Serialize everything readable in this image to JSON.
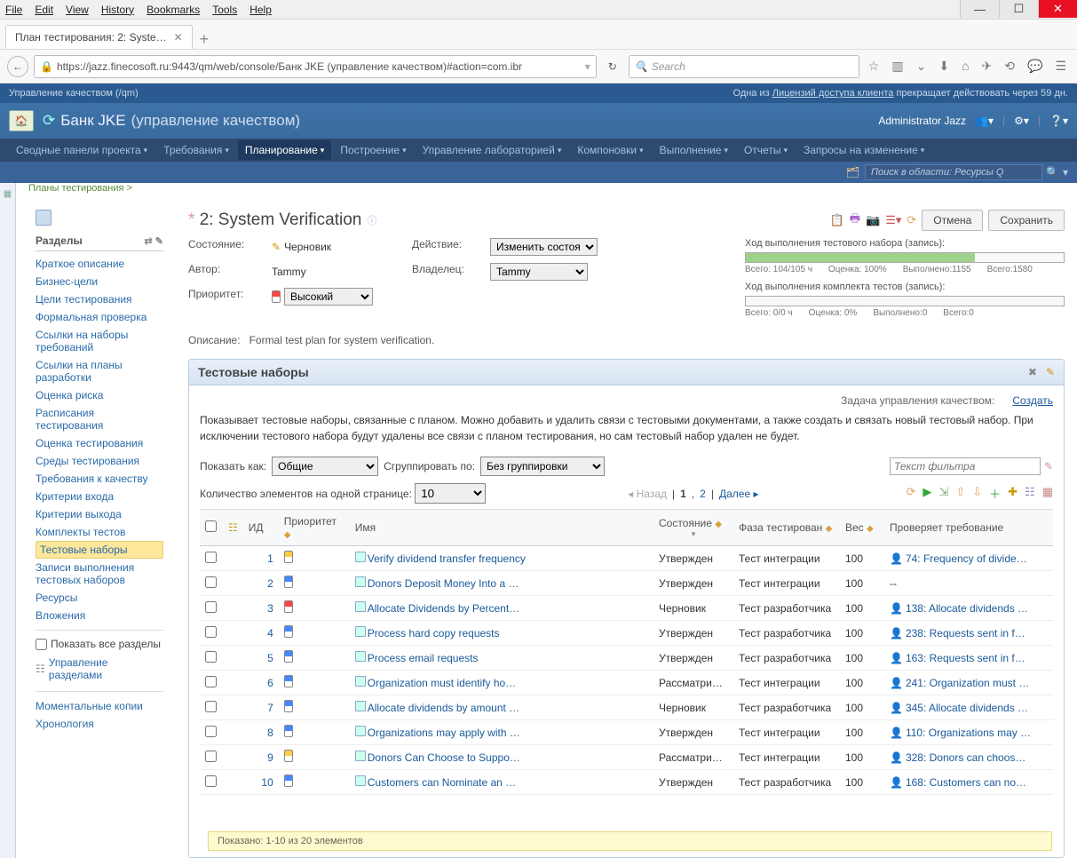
{
  "os_menu": [
    "File",
    "Edit",
    "View",
    "History",
    "Bookmarks",
    "Tools",
    "Help"
  ],
  "window": {
    "min": "—",
    "max": "☐",
    "close": "✕"
  },
  "browser_tab": {
    "title": "План тестирования: 2: Syste…"
  },
  "url": "https://jazz.finecosoft.ru:9443/qm/web/console/Банк JKE (управление качеством)#action=com.ibr",
  "search_placeholder": "Search",
  "topbar": {
    "left": "Управление качеством (/qm)",
    "right_prefix": "Одна из ",
    "right_link": "Лицензий доступа клиента",
    "right_suffix": " прекращает действовать через 59 дн."
  },
  "banner": {
    "title_main": "Банк JKE",
    "title_sub": "(управление качеством)",
    "user": "Administrator Jazz"
  },
  "nav": [
    {
      "label": "Сводные панели проекта",
      "active": false
    },
    {
      "label": "Требования",
      "active": false
    },
    {
      "label": "Планирование",
      "active": true
    },
    {
      "label": "Построение",
      "active": false
    },
    {
      "label": "Управление лабораторией",
      "active": false
    },
    {
      "label": "Компоновки",
      "active": false
    },
    {
      "label": "Выполнение",
      "active": false
    },
    {
      "label": "Отчеты",
      "active": false
    },
    {
      "label": "Запросы на изменение",
      "active": false
    }
  ],
  "scope_search": "Поиск в области: Ресурсы Q",
  "breadcrumb": "Планы тестирования >",
  "page_title": "2: System Verification",
  "buttons": {
    "cancel": "Отмена",
    "save": "Сохранить"
  },
  "sections_header": "Разделы",
  "sections": [
    "Краткое описание",
    "Бизнес-цели",
    "Цели тестирования",
    "Формальная проверка",
    "Ссылки на наборы требований",
    "Ссылки на планы разработки",
    "Оценка риска",
    "Расписания тестирования",
    "Оценка тестирования",
    "Среды тестирования",
    "Требования к качеству",
    "Критерии входа",
    "Критерии выхода",
    "Комплекты тестов",
    "Тестовые наборы",
    "Записи выполнения тестовых наборов",
    "Ресурсы",
    "Вложения"
  ],
  "selected_section_idx": 14,
  "show_all": "Показать все разделы",
  "manage_sections": "Управление разделами",
  "snapshots": "Моментальные копии",
  "chronology": "Хронология",
  "meta": {
    "state_lbl": "Состояние:",
    "state_val": "Черновик",
    "action_lbl": "Действие:",
    "action_val": "Изменить состоя",
    "author_lbl": "Автор:",
    "author_val": "Tammy",
    "owner_lbl": "Владелец:",
    "owner_val": "Tammy",
    "priority_lbl": "Приоритет:",
    "priority_val": "Высокий",
    "desc_lbl": "Описание:",
    "desc_val": "Formal test plan for system verification."
  },
  "progress1": {
    "title": "Ход выполнения тестового набора (запись):",
    "s1": "Всего: 104/105 ч",
    "s2": "Оценка: 100%",
    "s3": "Выполнено:1155",
    "s4": "Всего:1580"
  },
  "progress2": {
    "title": "Ход выполнения комплекта тестов (запись):",
    "s1": "Всего: 0/0 ч",
    "s2": "Оценка: 0%",
    "s3": "Выполнено:0",
    "s4": "Всего:0"
  },
  "panel": {
    "title": "Тестовые наборы",
    "task_lbl": "Задача управления качеством:",
    "create": "Создать",
    "desc": "Показывает тестовые наборы, связанные с планом. Можно добавить и удалить связи с тестовыми документами, а также создать и связать новый тестовый набор. При исключении тестового набора будут удалены все связи с планом тестирования, но сам тестовый набор удален не будет.",
    "show_as_lbl": "Показать как:",
    "show_as_val": "Общие",
    "group_lbl": "Сгруппировать по:",
    "group_val": "Без группировки",
    "filter_placeholder": "Текст фильтра",
    "page_size_lbl": "Количество элементов на одной странице:",
    "page_size_val": "10",
    "prev": "◂ Назад",
    "page1": "1",
    "page2": "2",
    "next": "Далее ▸",
    "cols": {
      "id": "ИД",
      "pri": "Приоритет",
      "name": "Имя",
      "state": "Состояние",
      "phase": "Фаза тестирован",
      "weight": "Вес",
      "req": "Проверяет требование"
    },
    "footer": "Показано: 1-10 из 20 элементов"
  },
  "rows": [
    {
      "id": "1",
      "pri": "y",
      "name": "Verify dividend transfer frequency",
      "state": "Утвержден",
      "phase": "Тест интеграции",
      "weight": "100",
      "req": "74: Frequency of divide…"
    },
    {
      "id": "2",
      "pri": "m",
      "name": "Donors Deposit Money Into a …",
      "state": "Утвержден",
      "phase": "Тест интеграции",
      "weight": "100",
      "req": "--"
    },
    {
      "id": "3",
      "pri": "h",
      "name": "Allocate Dividends by Percent…",
      "state": "Черновик",
      "phase": "Тест разработчика",
      "weight": "100",
      "req": "138: Allocate dividends …"
    },
    {
      "id": "4",
      "pri": "m",
      "name": "Process hard copy requests",
      "state": "Утвержден",
      "phase": "Тест разработчика",
      "weight": "100",
      "req": "238: Requests sent in f…"
    },
    {
      "id": "5",
      "pri": "m",
      "name": "Process email requests",
      "state": "Утвержден",
      "phase": "Тест разработчика",
      "weight": "100",
      "req": "163: Requests sent in f…"
    },
    {
      "id": "6",
      "pri": "m",
      "name": "Organization must identify ho…",
      "state": "Рассматри…",
      "phase": "Тест интеграции",
      "weight": "100",
      "req": "241: Organization must …"
    },
    {
      "id": "7",
      "pri": "m",
      "name": "Allocate dividends by amount …",
      "state": "Черновик",
      "phase": "Тест разработчика",
      "weight": "100",
      "req": "345: Allocate dividends …"
    },
    {
      "id": "8",
      "pri": "m",
      "name": "Organizations may apply with …",
      "state": "Утвержден",
      "phase": "Тест интеграции",
      "weight": "100",
      "req": "110: Organizations may …"
    },
    {
      "id": "9",
      "pri": "y",
      "name": "Donors Can Choose to Suppo…",
      "state": "Рассматри…",
      "phase": "Тест интеграции",
      "weight": "100",
      "req": "328: Donors can choos…"
    },
    {
      "id": "10",
      "pri": "m",
      "name": "Customers can Nominate an …",
      "state": "Утвержден",
      "phase": "Тест разработчика",
      "weight": "100",
      "req": "168: Customers can no…"
    }
  ]
}
